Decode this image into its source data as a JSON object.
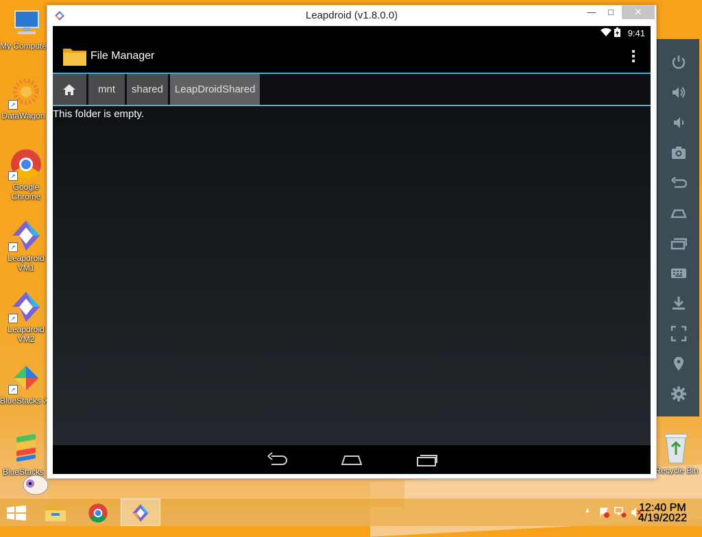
{
  "window": {
    "title": "Leapdroid (v1.8.0.0)",
    "min_symbol": "—",
    "max_symbol": "□",
    "close_symbol": "✕"
  },
  "android": {
    "status_time": "9:41",
    "app_title": "File Manager",
    "breadcrumbs": [
      "mnt",
      "shared",
      "LeapDroidShared"
    ],
    "empty_message": "This folder is empty."
  },
  "desktop_icons": [
    {
      "label": "My Computer",
      "icon": "computer-icon"
    },
    {
      "label": "DataWagon",
      "icon": "datawagon-icon"
    },
    {
      "label": "Google Chrome",
      "icon": "chrome-icon"
    },
    {
      "label": "Leapdroid VM1",
      "icon": "leapdroid-icon"
    },
    {
      "label": "Leapdroid VM2",
      "icon": "leapdroid-icon"
    },
    {
      "label": "BlueStacks X",
      "icon": "bluestacks-x-icon"
    },
    {
      "label": "BlueStacks",
      "icon": "bluestacks-icon"
    }
  ],
  "recycle_bin": {
    "label": "Recycle Bin"
  },
  "sidebar_tools": [
    "power",
    "volume-up",
    "volume-down",
    "camera",
    "back",
    "home",
    "recent-apps",
    "keyboard",
    "install-apk",
    "fullscreen",
    "location",
    "settings"
  ],
  "taskbar": {
    "clock_time": "12:40 PM",
    "clock_date": "4/19/2022"
  },
  "colors": {
    "accent_blue": "#33b5e5",
    "desktop_orange": "#f5a623",
    "sidebar_bg": "#3d4b55"
  }
}
